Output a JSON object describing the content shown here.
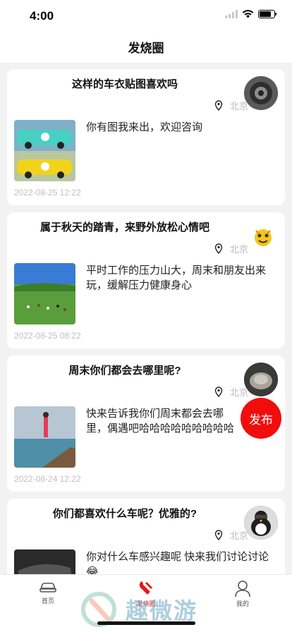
{
  "status_bar": {
    "time": "4:00"
  },
  "header": {
    "title": "发烧圈"
  },
  "posts": [
    {
      "title": "这样的车衣贴图喜欢吗",
      "location": "北京",
      "body": "你有图我来出，欢迎咨询",
      "date": "2022-08-25 12:22"
    },
    {
      "title": "属于秋天的踏青，来野外放松心情吧",
      "location": "北京",
      "body": "平时工作的压力山大，周末和朋友出来玩，缓解压力健康身心",
      "date": "2022-08-25 08:22"
    },
    {
      "title": "周末你们都会去哪里呢?",
      "location": "北京",
      "body": "快来告诉我你们周末都会去哪里，偶遇吧哈哈哈哈哈哈哈哈哈",
      "date": "2022-08-24 12:22"
    },
    {
      "title": "你们都喜欢什么车呢？优雅的?",
      "location": "北京",
      "body": "你对什么车感兴趣呢 快来我们讨论讨论😂",
      "date": ""
    }
  ],
  "fab": {
    "label": "发布"
  },
  "tabs": [
    {
      "label": "首页",
      "icon": "car-icon"
    },
    {
      "label": "发烧圈",
      "icon": "wrench-icon"
    },
    {
      "label": "我的",
      "icon": "person-icon"
    }
  ],
  "watermark": {
    "text": "趣微游"
  },
  "colors": {
    "accent": "#f20d0d",
    "date_gray": "#c0c0c0",
    "location_gray": "#bbbbbb"
  }
}
